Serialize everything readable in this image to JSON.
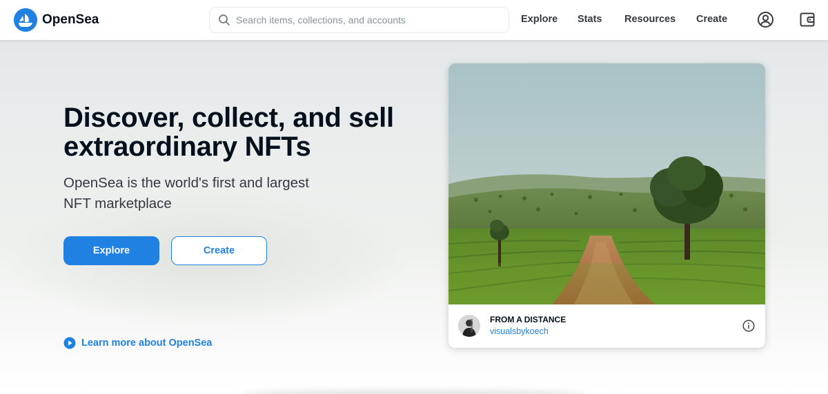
{
  "header": {
    "brand": "OpenSea",
    "search": {
      "placeholder": "Search items, collections, and accounts",
      "value": ""
    },
    "nav": {
      "explore": "Explore",
      "stats": "Stats",
      "resources": "Resources",
      "create": "Create"
    },
    "icons": {
      "logo": "opensea-logo-icon",
      "search": "search-icon",
      "account": "account-icon",
      "wallet": "wallet-icon"
    }
  },
  "hero": {
    "headline": "Discover, collect, and sell extraordinary NFTs",
    "subhead": "OpenSea is the world's first and largest NFT marketplace",
    "explore_button": "Explore",
    "create_button": "Create",
    "learn_more": "Learn more about OpenSea"
  },
  "featured": {
    "title": "FROM A DISTANCE",
    "artist": "visualsbykoech",
    "image": "tea-plantation-landscape",
    "icons": {
      "info": "info-icon",
      "avatar": "avatar"
    }
  },
  "colors": {
    "accent": "#2081e2",
    "text_primary": "#04111d",
    "text_secondary": "#353840",
    "placeholder": "#8a939b",
    "border": "#e5e8eb"
  }
}
